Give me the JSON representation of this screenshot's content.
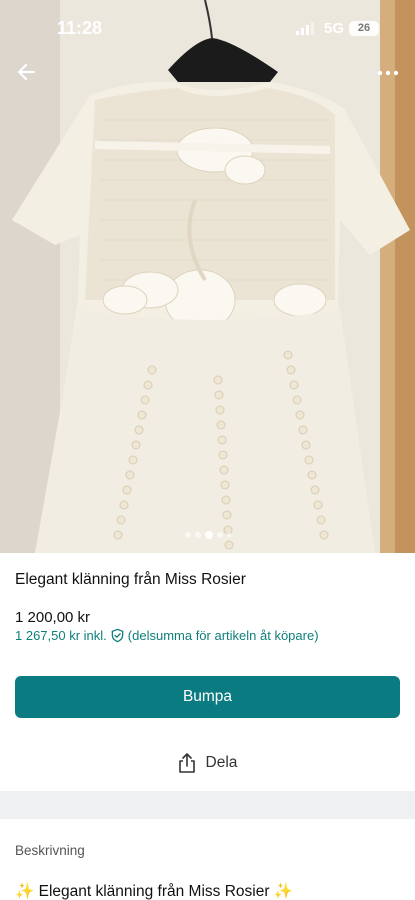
{
  "status_bar": {
    "time": "11:28",
    "network": "5G",
    "battery": "26"
  },
  "icons": {
    "back": "arrow-left-icon",
    "more": "more-horizontal-icon",
    "shield": "shield-check-icon",
    "share": "share-icon"
  },
  "carousel": {
    "image_description_icon": "photo",
    "dots": 5,
    "active_index": 2
  },
  "listing": {
    "title": "Elegant klänning från Miss Rosier",
    "price": "1 200,00 kr",
    "price_incl": "1 267,50 kr inkl.",
    "price_incl_note": "(delsumma för artikeln åt köpare)"
  },
  "actions": {
    "bump_label": "Bumpa",
    "share_label": "Dela"
  },
  "description": {
    "label": "Beskrivning",
    "text": "✨ Elegant klänning från Miss Rosier ✨"
  },
  "colors": {
    "accent": "#0a7b80",
    "accent_text": "#0f7f7a",
    "separator": "#eff0f2"
  }
}
